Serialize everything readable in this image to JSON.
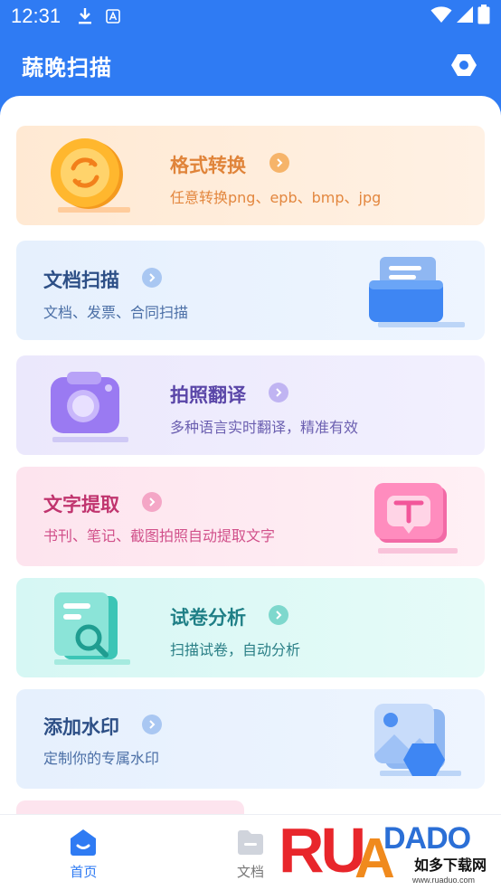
{
  "status_bar": {
    "time": "12:31"
  },
  "header": {
    "title": "蔬晚扫描"
  },
  "cards": [
    {
      "title": "格式转换",
      "subtitle": "任意转换png、epb、bmp、jpg",
      "color": "#e0843a"
    },
    {
      "title": "文档扫描",
      "subtitle": "文档、发票、合同扫描",
      "color": "#2d4f86"
    },
    {
      "title": "拍照翻译",
      "subtitle": "多种语言实时翻译，精准有效",
      "color": "#5a46a8"
    },
    {
      "title": "文字提取",
      "subtitle": "书刊、笔记、截图拍照自动提取文字",
      "color": "#c0346e"
    },
    {
      "title": "试卷分析",
      "subtitle": "扫描试卷，自动分析",
      "color": "#1f7f86"
    },
    {
      "title": "添加水印",
      "subtitle": "定制你的专属水印",
      "color": "#2d4f86"
    }
  ],
  "bottom_nav": [
    {
      "label": "首页",
      "active": true
    },
    {
      "label": "文档",
      "active": false
    }
  ],
  "watermark": {
    "brand": "RUANDADO",
    "cn": "如多下载网",
    "url": "www.ruaduo.com"
  }
}
